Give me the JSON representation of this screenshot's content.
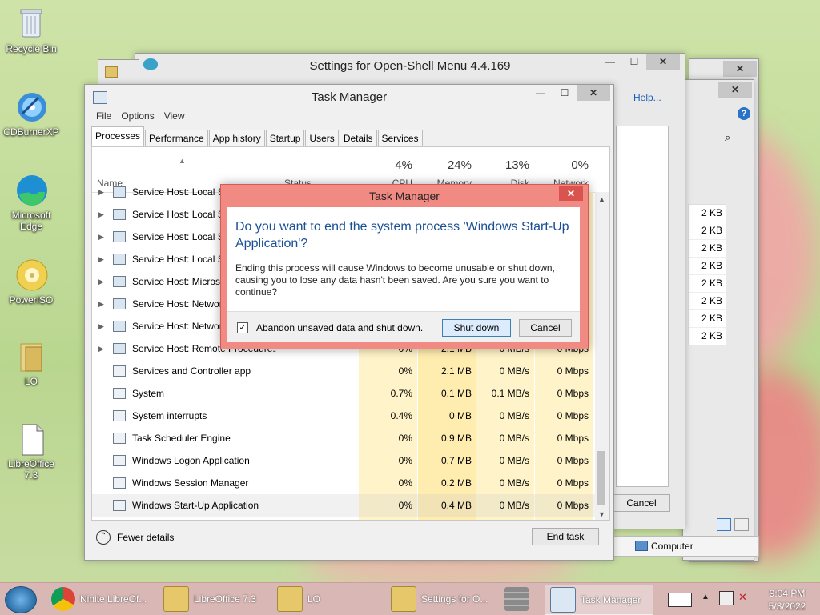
{
  "desktop": {
    "icons": [
      {
        "label": "Recycle Bin"
      },
      {
        "label": "CDBurnerXP"
      },
      {
        "label": "Microsoft Edge"
      },
      {
        "label": "PowerISO"
      },
      {
        "label": "LO"
      },
      {
        "label": "LibreOffice 7.3"
      }
    ]
  },
  "openshell_window": {
    "title": "Settings for Open-Shell Menu 4.4.169",
    "help_link": "Help...",
    "cancel_label": "Cancel"
  },
  "explorer_window": {
    "sizes": [
      "2 KB",
      "2 KB",
      "2 KB",
      "2 KB",
      "2 KB",
      "2 KB",
      "2 KB",
      "2 KB"
    ],
    "status_label": "Computer"
  },
  "task_manager": {
    "title": "Task Manager",
    "menu": [
      "File",
      "Options",
      "View"
    ],
    "tabs": [
      "Processes",
      "Performance",
      "App history",
      "Startup",
      "Users",
      "Details",
      "Services"
    ],
    "columns": {
      "name": "Name",
      "status": "Status",
      "cpu_pct": "4%",
      "cpu": "CPU",
      "mem_pct": "24%",
      "mem": "Memory",
      "disk_pct": "13%",
      "disk": "Disk",
      "net_pct": "0%",
      "net": "Network"
    },
    "rows": [
      {
        "name": "Service Host: Local Se",
        "cpu": "",
        "mem": "",
        "disk": "",
        "net": "",
        "group": true
      },
      {
        "name": "Service Host: Local Se",
        "cpu": "",
        "mem": "",
        "disk": "",
        "net": "",
        "group": true
      },
      {
        "name": "Service Host: Local Sy",
        "cpu": "",
        "mem": "",
        "disk": "",
        "net": "",
        "group": true
      },
      {
        "name": "Service Host: Local Sy",
        "cpu": "",
        "mem": "",
        "disk": "",
        "net": "",
        "group": true
      },
      {
        "name": "Service Host: Microsc",
        "cpu": "",
        "mem": "",
        "disk": "",
        "net": "",
        "group": true
      },
      {
        "name": "Service Host: Networ",
        "cpu": "",
        "mem": "",
        "disk": "",
        "net": "",
        "group": true
      },
      {
        "name": "Service Host: Networ",
        "cpu": "",
        "mem": "",
        "disk": "",
        "net": "",
        "group": true
      },
      {
        "name": "Service Host: Remote Procedure...",
        "cpu": "0%",
        "mem": "2.1 MB",
        "disk": "0 MB/s",
        "net": "0 Mbps",
        "group": true
      },
      {
        "name": "Services and Controller app",
        "cpu": "0%",
        "mem": "2.1 MB",
        "disk": "0 MB/s",
        "net": "0 Mbps",
        "group": false
      },
      {
        "name": "System",
        "cpu": "0.7%",
        "mem": "0.1 MB",
        "disk": "0.1 MB/s",
        "net": "0 Mbps",
        "group": false
      },
      {
        "name": "System interrupts",
        "cpu": "0.4%",
        "mem": "0 MB",
        "disk": "0 MB/s",
        "net": "0 Mbps",
        "group": false
      },
      {
        "name": "Task Scheduler Engine",
        "cpu": "0%",
        "mem": "0.9 MB",
        "disk": "0 MB/s",
        "net": "0 Mbps",
        "group": false
      },
      {
        "name": "Windows Logon Application",
        "cpu": "0%",
        "mem": "0.7 MB",
        "disk": "0 MB/s",
        "net": "0 Mbps",
        "group": false
      },
      {
        "name": "Windows Session Manager",
        "cpu": "0%",
        "mem": "0.2 MB",
        "disk": "0 MB/s",
        "net": "0 Mbps",
        "group": false
      },
      {
        "name": "Windows Start-Up Application",
        "cpu": "0%",
        "mem": "0.4 MB",
        "disk": "0 MB/s",
        "net": "0 Mbps",
        "group": false
      }
    ],
    "fewer_details": "Fewer details",
    "end_task": "End task"
  },
  "dialog": {
    "title": "Task Manager",
    "heading": "Do you want to end the system process 'Windows Start-Up Application'?",
    "body": "Ending this process will cause Windows to become unusable or shut down, causing you to lose any data hasn't been saved. Are you sure you want to continue?",
    "checkbox_label": "Abandon unsaved data and shut down.",
    "checkbox_checked": true,
    "shutdown_label": "Shut down",
    "cancel_label": "Cancel",
    "accent_color": "#f08a82"
  },
  "taskbar": {
    "items": [
      {
        "label": "Ninite LibreOf..."
      },
      {
        "label": "LibreOffice 7.3"
      },
      {
        "label": "LO"
      },
      {
        "label": "Settings for O..."
      },
      {
        "label": ""
      },
      {
        "label": "Task Manager"
      }
    ],
    "time": "9:04 PM",
    "date": "5/3/2022"
  }
}
